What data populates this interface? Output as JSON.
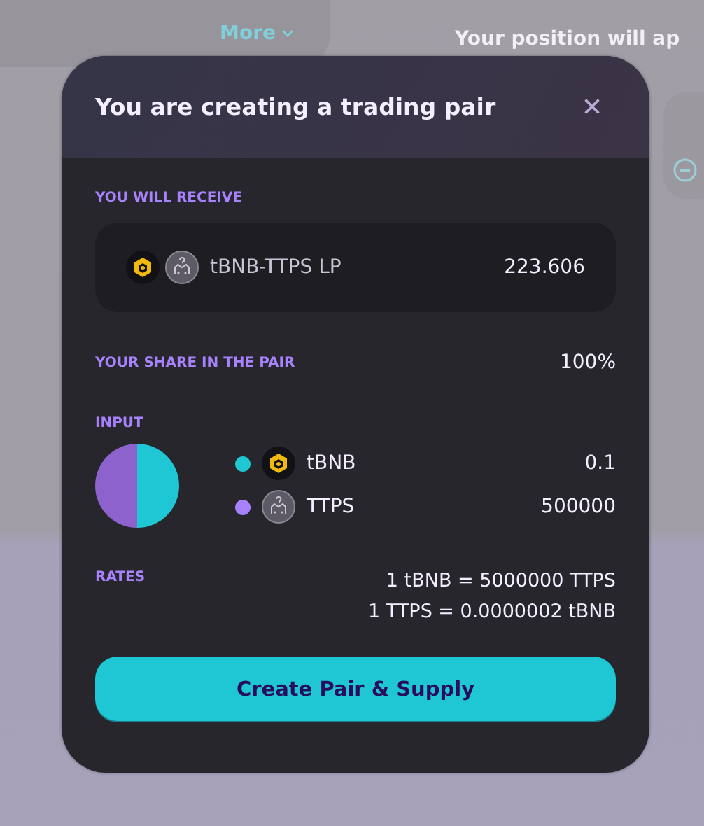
{
  "background": {
    "more_link": "More",
    "position_text": "Your position will ap"
  },
  "modal": {
    "title": "You are creating a trading pair",
    "close": "×",
    "receive": {
      "label": "YOU WILL RECEIVE",
      "token": "tBNB-TTPS LP",
      "amount": "223.606"
    },
    "share": {
      "label": "YOUR SHARE IN THE PAIR",
      "value": "100%"
    },
    "input": {
      "label": "INPUT",
      "items": [
        {
          "kind": "bnb",
          "name": "tBNB",
          "amount": "0.1",
          "color": "#1fc7d4"
        },
        {
          "kind": "unknown",
          "name": "TTPS",
          "amount": "500000",
          "color": "#a881fc"
        }
      ]
    },
    "rates": {
      "label": "RATES",
      "lines": [
        "1 tBNB = 5000000 TTPS",
        "1 TTPS = 0.0000002 tBNB"
      ]
    },
    "button": "Create Pair & Supply"
  }
}
